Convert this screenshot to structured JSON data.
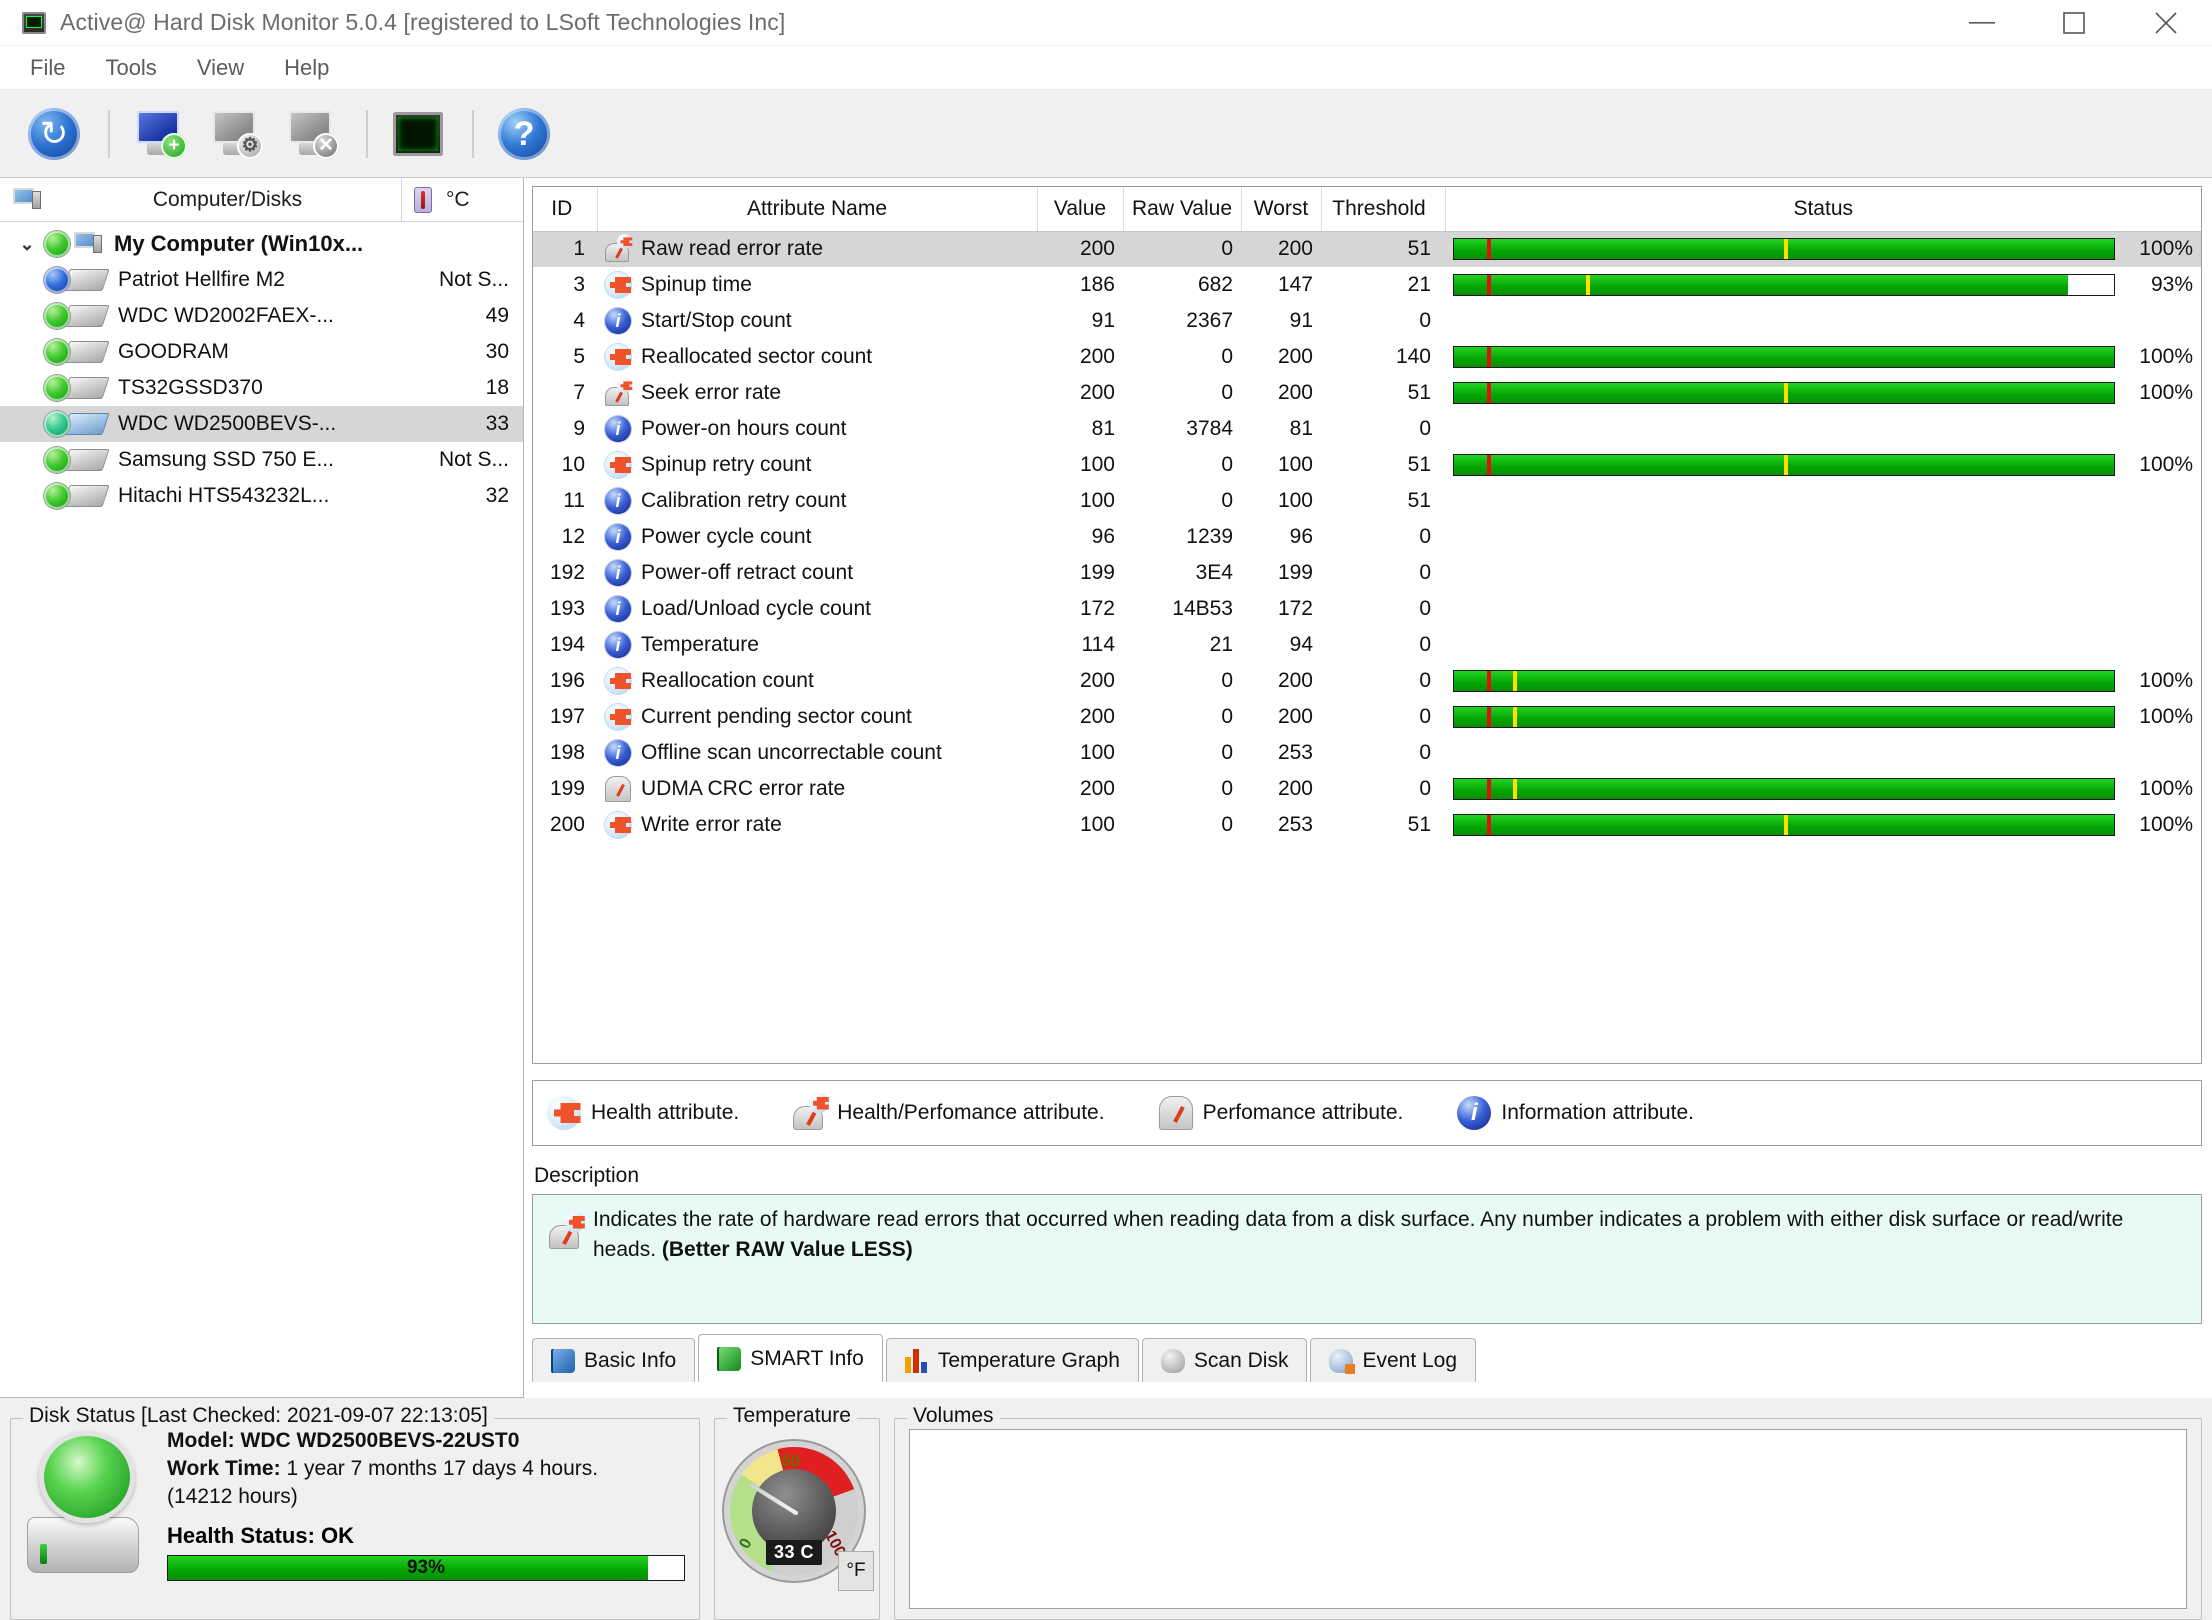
{
  "window": {
    "title": "Active@ Hard Disk Monitor 5.0.4 [registered to LSoft Technologies Inc]",
    "minimize": "─",
    "maximize": "□",
    "close": "✕"
  },
  "menu": {
    "items": [
      "File",
      "Tools",
      "View",
      "Help"
    ]
  },
  "toolbar": {
    "buttons": [
      {
        "name": "refresh-button",
        "icon": "refresh-icon",
        "glyph": "↻"
      },
      {
        "name": "add-computer-button",
        "icon": "monitor-add-icon",
        "glyph": "+"
      },
      {
        "name": "configure-computer-button",
        "icon": "monitor-gear-icon",
        "glyph": "⚙"
      },
      {
        "name": "remove-computer-button",
        "icon": "monitor-remove-icon",
        "glyph": "✕"
      },
      {
        "name": "disk-monitor-button",
        "icon": "crt-monitor-icon",
        "glyph": ""
      },
      {
        "name": "help-button",
        "icon": "help-icon",
        "glyph": "?"
      }
    ]
  },
  "sidebar": {
    "header": {
      "tree_label": "Computer/Disks",
      "temp_label": "°C",
      "temp_icon": "thermometer-icon"
    },
    "root": {
      "label": "My Computer (Win10x...",
      "temp": "",
      "expanded": true,
      "led": "green"
    },
    "items": [
      {
        "label": "Patriot Hellfire M2",
        "temp": "Not S...",
        "led": "blue",
        "selected": false
      },
      {
        "label": "WDC WD2002FAEX-...",
        "temp": "49",
        "led": "green",
        "selected": false
      },
      {
        "label": "GOODRAM",
        "temp": "30",
        "led": "green",
        "selected": false
      },
      {
        "label": "TS32GSSD370",
        "temp": "18",
        "led": "green",
        "selected": false
      },
      {
        "label": "WDC WD2500BEVS-...",
        "temp": "33",
        "led": "teal",
        "selected": true
      },
      {
        "label": "Samsung SSD 750 E...",
        "temp": "Not S...",
        "led": "green",
        "selected": false
      },
      {
        "label": "Hitachi HTS543232L...",
        "temp": "32",
        "led": "green",
        "selected": false
      }
    ]
  },
  "attributes_table": {
    "columns": [
      "ID",
      "Attribute Name",
      "Value",
      "Raw Value",
      "Worst",
      "Threshold",
      "Status"
    ],
    "rows": [
      {
        "id": "1",
        "icon": "healthperf",
        "name": "Raw read error rate",
        "value": "200",
        "raw": "0",
        "worst": "200",
        "threshold": "51",
        "bar": true,
        "fill_pct": 100,
        "pct_label": "100%",
        "red_at": 5,
        "yellow_at": 50,
        "selected": true
      },
      {
        "id": "3",
        "icon": "health",
        "name": "Spinup time",
        "value": "186",
        "raw": "682",
        "worst": "147",
        "threshold": "21",
        "bar": true,
        "fill_pct": 93,
        "pct_label": "93%",
        "red_at": 5,
        "yellow_at": 20,
        "selected": false
      },
      {
        "id": "4",
        "icon": "info",
        "name": "Start/Stop count",
        "value": "91",
        "raw": "2367",
        "worst": "91",
        "threshold": "0",
        "bar": false,
        "fill_pct": 0,
        "pct_label": "",
        "red_at": 0,
        "yellow_at": 0,
        "selected": false
      },
      {
        "id": "5",
        "icon": "health",
        "name": "Reallocated sector count",
        "value": "200",
        "raw": "0",
        "worst": "200",
        "threshold": "140",
        "bar": true,
        "fill_pct": 100,
        "pct_label": "100%",
        "red_at": 5,
        "yellow_at": 0,
        "selected": false
      },
      {
        "id": "7",
        "icon": "healthperf",
        "name": "Seek error rate",
        "value": "200",
        "raw": "0",
        "worst": "200",
        "threshold": "51",
        "bar": true,
        "fill_pct": 100,
        "pct_label": "100%",
        "red_at": 5,
        "yellow_at": 50,
        "selected": false
      },
      {
        "id": "9",
        "icon": "info",
        "name": "Power-on hours count",
        "value": "81",
        "raw": "3784",
        "worst": "81",
        "threshold": "0",
        "bar": false,
        "fill_pct": 0,
        "pct_label": "",
        "red_at": 0,
        "yellow_at": 0,
        "selected": false
      },
      {
        "id": "10",
        "icon": "health",
        "name": "Spinup retry count",
        "value": "100",
        "raw": "0",
        "worst": "100",
        "threshold": "51",
        "bar": true,
        "fill_pct": 100,
        "pct_label": "100%",
        "red_at": 5,
        "yellow_at": 50,
        "selected": false
      },
      {
        "id": "11",
        "icon": "info",
        "name": "Calibration retry count",
        "value": "100",
        "raw": "0",
        "worst": "100",
        "threshold": "51",
        "bar": false,
        "fill_pct": 0,
        "pct_label": "",
        "red_at": 0,
        "yellow_at": 0,
        "selected": false
      },
      {
        "id": "12",
        "icon": "info",
        "name": "Power cycle count",
        "value": "96",
        "raw": "1239",
        "worst": "96",
        "threshold": "0",
        "bar": false,
        "fill_pct": 0,
        "pct_label": "",
        "red_at": 0,
        "yellow_at": 0,
        "selected": false
      },
      {
        "id": "192",
        "icon": "info",
        "name": "Power-off retract count",
        "value": "199",
        "raw": "3E4",
        "worst": "199",
        "threshold": "0",
        "bar": false,
        "fill_pct": 0,
        "pct_label": "",
        "red_at": 0,
        "yellow_at": 0,
        "selected": false
      },
      {
        "id": "193",
        "icon": "info",
        "name": "Load/Unload cycle count",
        "value": "172",
        "raw": "14B53",
        "worst": "172",
        "threshold": "0",
        "bar": false,
        "fill_pct": 0,
        "pct_label": "",
        "red_at": 0,
        "yellow_at": 0,
        "selected": false
      },
      {
        "id": "194",
        "icon": "info",
        "name": "Temperature",
        "value": "114",
        "raw": "21",
        "worst": "94",
        "threshold": "0",
        "bar": false,
        "fill_pct": 0,
        "pct_label": "",
        "red_at": 0,
        "yellow_at": 0,
        "selected": false
      },
      {
        "id": "196",
        "icon": "health",
        "name": "Reallocation count",
        "value": "200",
        "raw": "0",
        "worst": "200",
        "threshold": "0",
        "bar": true,
        "fill_pct": 100,
        "pct_label": "100%",
        "red_at": 5,
        "yellow_at": 9,
        "selected": false
      },
      {
        "id": "197",
        "icon": "health",
        "name": "Current pending sector count",
        "value": "200",
        "raw": "0",
        "worst": "200",
        "threshold": "0",
        "bar": true,
        "fill_pct": 100,
        "pct_label": "100%",
        "red_at": 5,
        "yellow_at": 9,
        "selected": false
      },
      {
        "id": "198",
        "icon": "info",
        "name": "Offline scan uncorrectable count",
        "value": "100",
        "raw": "0",
        "worst": "253",
        "threshold": "0",
        "bar": false,
        "fill_pct": 0,
        "pct_label": "",
        "red_at": 0,
        "yellow_at": 0,
        "selected": false
      },
      {
        "id": "199",
        "icon": "perf",
        "name": "UDMA CRC error rate",
        "value": "200",
        "raw": "0",
        "worst": "200",
        "threshold": "0",
        "bar": true,
        "fill_pct": 100,
        "pct_label": "100%",
        "red_at": 5,
        "yellow_at": 9,
        "selected": false
      },
      {
        "id": "200",
        "icon": "health",
        "name": "Write error rate",
        "value": "100",
        "raw": "0",
        "worst": "253",
        "threshold": "51",
        "bar": true,
        "fill_pct": 100,
        "pct_label": "100%",
        "red_at": 5,
        "yellow_at": 50,
        "selected": false
      }
    ]
  },
  "legend": {
    "items": [
      {
        "icon": "health",
        "label": "Health attribute."
      },
      {
        "icon": "healthperf",
        "label": "Health/Perfomance attribute."
      },
      {
        "icon": "perf",
        "label": "Perfomance attribute."
      },
      {
        "icon": "info",
        "label": "Information attribute."
      }
    ]
  },
  "description": {
    "label": "Description",
    "icon": "healthperf-icon",
    "text": "Indicates the rate of hardware read errors that occurred when reading data from a disk surface. Any number indicates a problem with either disk surface or read/write heads. ",
    "bold_suffix": "(Better RAW Value LESS)"
  },
  "tabs": [
    {
      "label": "Basic Info",
      "icon": "book-blue",
      "active": false
    },
    {
      "label": "SMART Info",
      "icon": "book-green",
      "active": true
    },
    {
      "label": "Temperature Graph",
      "icon": "chart",
      "active": false
    },
    {
      "label": "Scan Disk",
      "icon": "scan",
      "active": false
    },
    {
      "label": "Event Log",
      "icon": "log",
      "active": false
    }
  ],
  "status": {
    "disk_status_title": "Disk Status [Last Checked: 2021-09-07 22:13:05]",
    "model_label": "Model:",
    "model_value": "WDC WD2500BEVS-22UST0",
    "worktime_label": "Work Time:",
    "worktime_value": "1 year 7 months 17 days 4 hours.",
    "worktime_hours": "(14212 hours)",
    "health_label": "Health Status: OK",
    "health_pct_label": "93%",
    "health_pct": 93,
    "temperature_title": "Temperature",
    "gauge_value": "33 C",
    "gauge_min": "0",
    "gauge_mid": "50",
    "gauge_max": "100",
    "unit_toggle": "°F",
    "volumes_title": "Volumes"
  },
  "colors": {
    "bar_green": "#03a403",
    "bar_red": "#e01010",
    "bar_yellow": "#ffe000",
    "selection": "#d6d6d6",
    "desc_bg": "#e8faf5"
  }
}
